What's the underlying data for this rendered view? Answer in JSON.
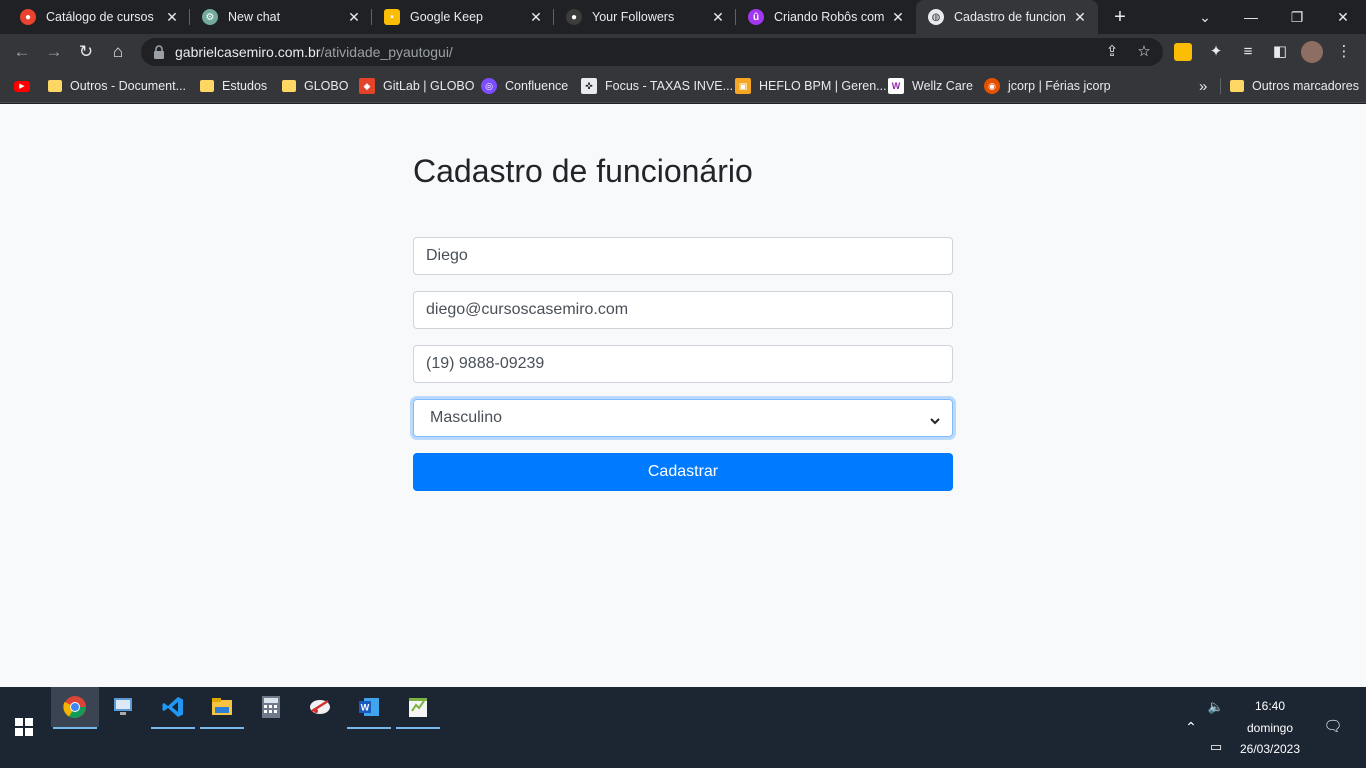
{
  "browser": {
    "tabs": [
      {
        "title": "Catálogo de cursos",
        "icon": "udemy-icon",
        "color": "#e8432e",
        "active": false
      },
      {
        "title": "New chat",
        "icon": "chatgpt-icon",
        "color": "#74aa9c",
        "active": false
      },
      {
        "title": "Google Keep",
        "icon": "keep-icon",
        "color": "#fbbc04",
        "active": false
      },
      {
        "title": "Your Followers",
        "icon": "github-icon",
        "color": "#3c3c3c",
        "active": false
      },
      {
        "title": "Criando Robôs com Py",
        "icon": "udemy-purple-icon",
        "color": "#a435f0",
        "active": false
      },
      {
        "title": "Cadastro de funcionár",
        "icon": "globe-icon",
        "color": "#e8eaed",
        "active": true
      }
    ],
    "address": {
      "domain": "gabrielcasemiro.com.br",
      "path": "/atividade_pyautogui/"
    },
    "bookmarks": [
      {
        "label": "",
        "icon": "youtube-icon"
      },
      {
        "label": "Outros - Document...",
        "icon": "folder-icon"
      },
      {
        "label": "Estudos",
        "icon": "folder-icon"
      },
      {
        "label": "GLOBO",
        "icon": "folder-icon"
      },
      {
        "label": "GitLab | GLOBO",
        "icon": "gitlab-icon"
      },
      {
        "label": "Confluence",
        "icon": "confluence-icon"
      },
      {
        "label": "Focus - TAXAS INVE...",
        "icon": "focus-icon"
      },
      {
        "label": "HEFLO BPM | Geren...",
        "icon": "heflo-icon"
      },
      {
        "label": "Wellz Care",
        "icon": "wellz-icon"
      },
      {
        "label": "jcorp | Férias jcorp",
        "icon": "jcorp-icon"
      }
    ],
    "bookmarks_overflow": "»",
    "other_bookmarks": "Outros marcadores"
  },
  "form": {
    "title": "Cadastro de funcionário",
    "name_value": "Diego",
    "email_value": "diego@cursoscasemiro.com",
    "phone_value": "(19) 9888-09239",
    "gender_selected": "Masculino",
    "submit_label": "Cadastrar"
  },
  "taskbar": {
    "apps": [
      "chrome-icon",
      "remote-desktop-icon",
      "vscode-icon",
      "file-explorer-icon",
      "calculator-icon",
      "snipping-tool-icon",
      "word-icon",
      "notepad-plus-icon"
    ],
    "time": "16:40",
    "day": "domingo",
    "date": "26/03/2023"
  },
  "colors": {
    "primary": "#007bff",
    "page_bg": "#f8f9fa",
    "chrome_dark": "#202124",
    "taskbar": "#1c2633"
  }
}
